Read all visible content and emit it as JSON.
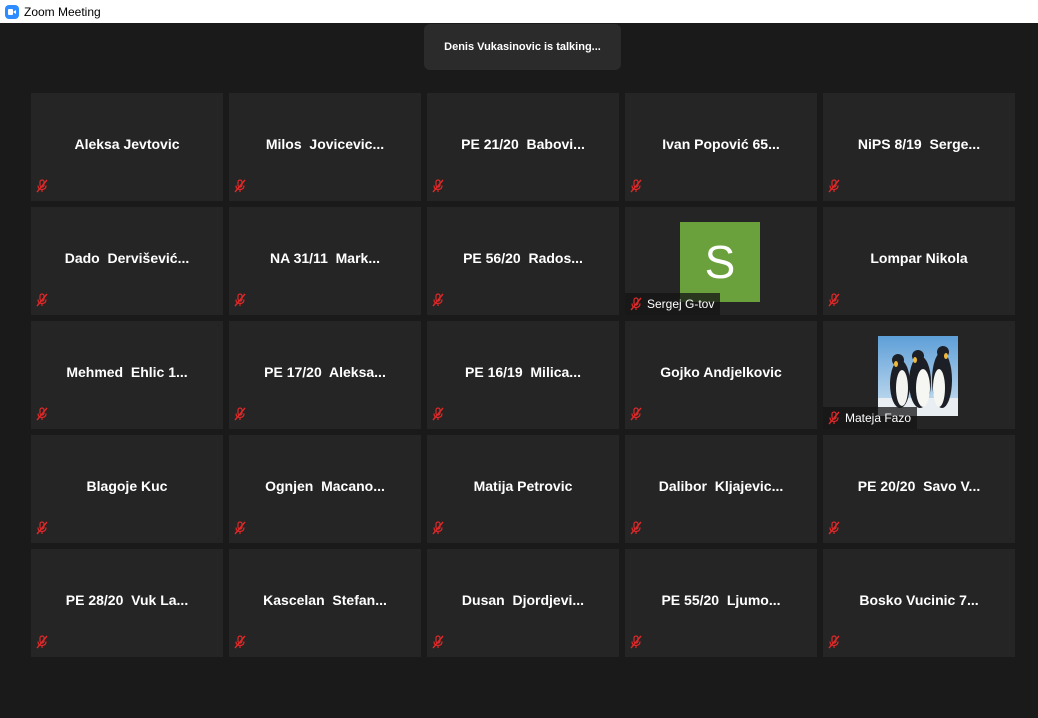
{
  "window": {
    "title": "Zoom Meeting"
  },
  "banner": {
    "text": "Denis Vukasinovic is talking..."
  },
  "participants": [
    {
      "name": "Aleksa Jevtovic",
      "muted": true
    },
    {
      "name": "Milos  Jovicevic...",
      "muted": true
    },
    {
      "name": "PE 21/20  Babovi...",
      "muted": true
    },
    {
      "name": "Ivan Popović 65...",
      "muted": true
    },
    {
      "name": "NiPS 8/19  Serge...",
      "muted": true
    },
    {
      "name": "Dado  Dervišević...",
      "muted": true
    },
    {
      "name": "NA 31/11  Mark...",
      "muted": true
    },
    {
      "name": "PE 56/20  Rados...",
      "muted": true
    },
    {
      "name": "Sergej G-tov",
      "muted": true,
      "avatar_letter": "S",
      "avatar_color": "#6aa13c"
    },
    {
      "name": "Lompar Nikola",
      "muted": true
    },
    {
      "name": "Mehmed  Ehlic 1...",
      "muted": true
    },
    {
      "name": "PE 17/20  Aleksa...",
      "muted": true
    },
    {
      "name": "PE 16/19  Milica...",
      "muted": true
    },
    {
      "name": "Gojko Andjelkovic",
      "muted": true
    },
    {
      "name": "Mateja Fazo",
      "muted": true,
      "avatar_image": "penguins-photo"
    },
    {
      "name": "Blagoje Kuc",
      "muted": true
    },
    {
      "name": "Ognjen  Macano...",
      "muted": true
    },
    {
      "name": "Matija Petrovic",
      "muted": true
    },
    {
      "name": "Dalibor  Kljajevic...",
      "muted": true
    },
    {
      "name": "PE 20/20  Savo V...",
      "muted": true
    },
    {
      "name": "PE 28/20  Vuk La...",
      "muted": true
    },
    {
      "name": "Kascelan  Stefan...",
      "muted": true
    },
    {
      "name": "Dusan  Djordjevi...",
      "muted": true
    },
    {
      "name": "PE 55/20  Ljumo...",
      "muted": true
    },
    {
      "name": "Bosko Vucinic 7...",
      "muted": true
    }
  ],
  "colors": {
    "background": "#1a1a1a",
    "tile": "#252525",
    "mute_red": "#e02828",
    "app_blue": "#2d8cff"
  }
}
